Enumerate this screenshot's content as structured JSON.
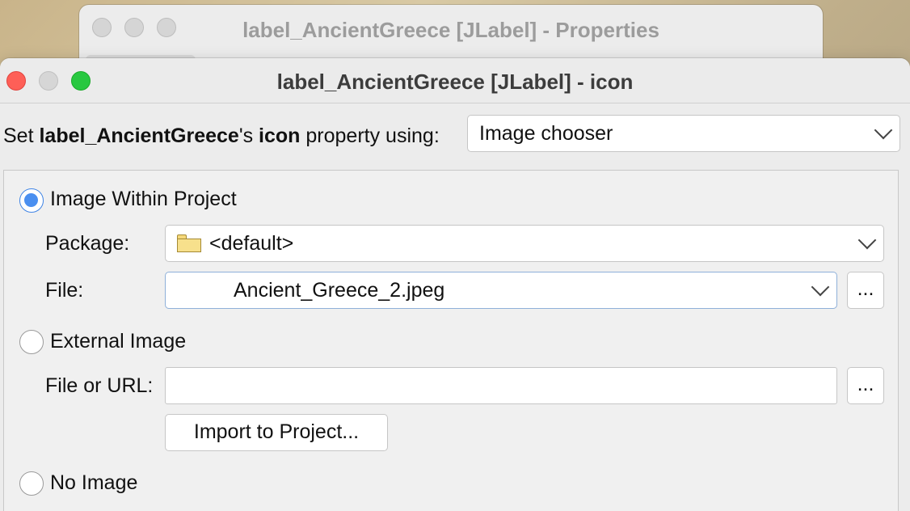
{
  "background_window": {
    "title": "label_AncientGreece [JLabel] - Properties"
  },
  "dialog": {
    "title": "label_AncientGreece [JLabel] - icon",
    "set_prefix": "Set ",
    "component_name": "label_AncientGreece",
    "possessive": "'s ",
    "property_name": "icon",
    "set_suffix": " property using:",
    "method_select": {
      "value": "Image chooser"
    }
  },
  "options": {
    "within_project": {
      "label": "Image Within Project",
      "checked": true,
      "package_label": "Package:",
      "package_value": "<default>",
      "file_label": "File:",
      "file_value": "Ancient_Greece_2.jpeg",
      "browse_label": "..."
    },
    "external": {
      "label": "External Image",
      "checked": false,
      "file_url_label": "File or URL:",
      "file_url_value": "",
      "browse_label": "...",
      "import_label": "Import to Project..."
    },
    "none": {
      "label": "No Image",
      "checked": false
    }
  },
  "colors": {
    "accent": "#4a8ff0",
    "close_light": "#fe5f57",
    "max_light": "#28c840"
  }
}
